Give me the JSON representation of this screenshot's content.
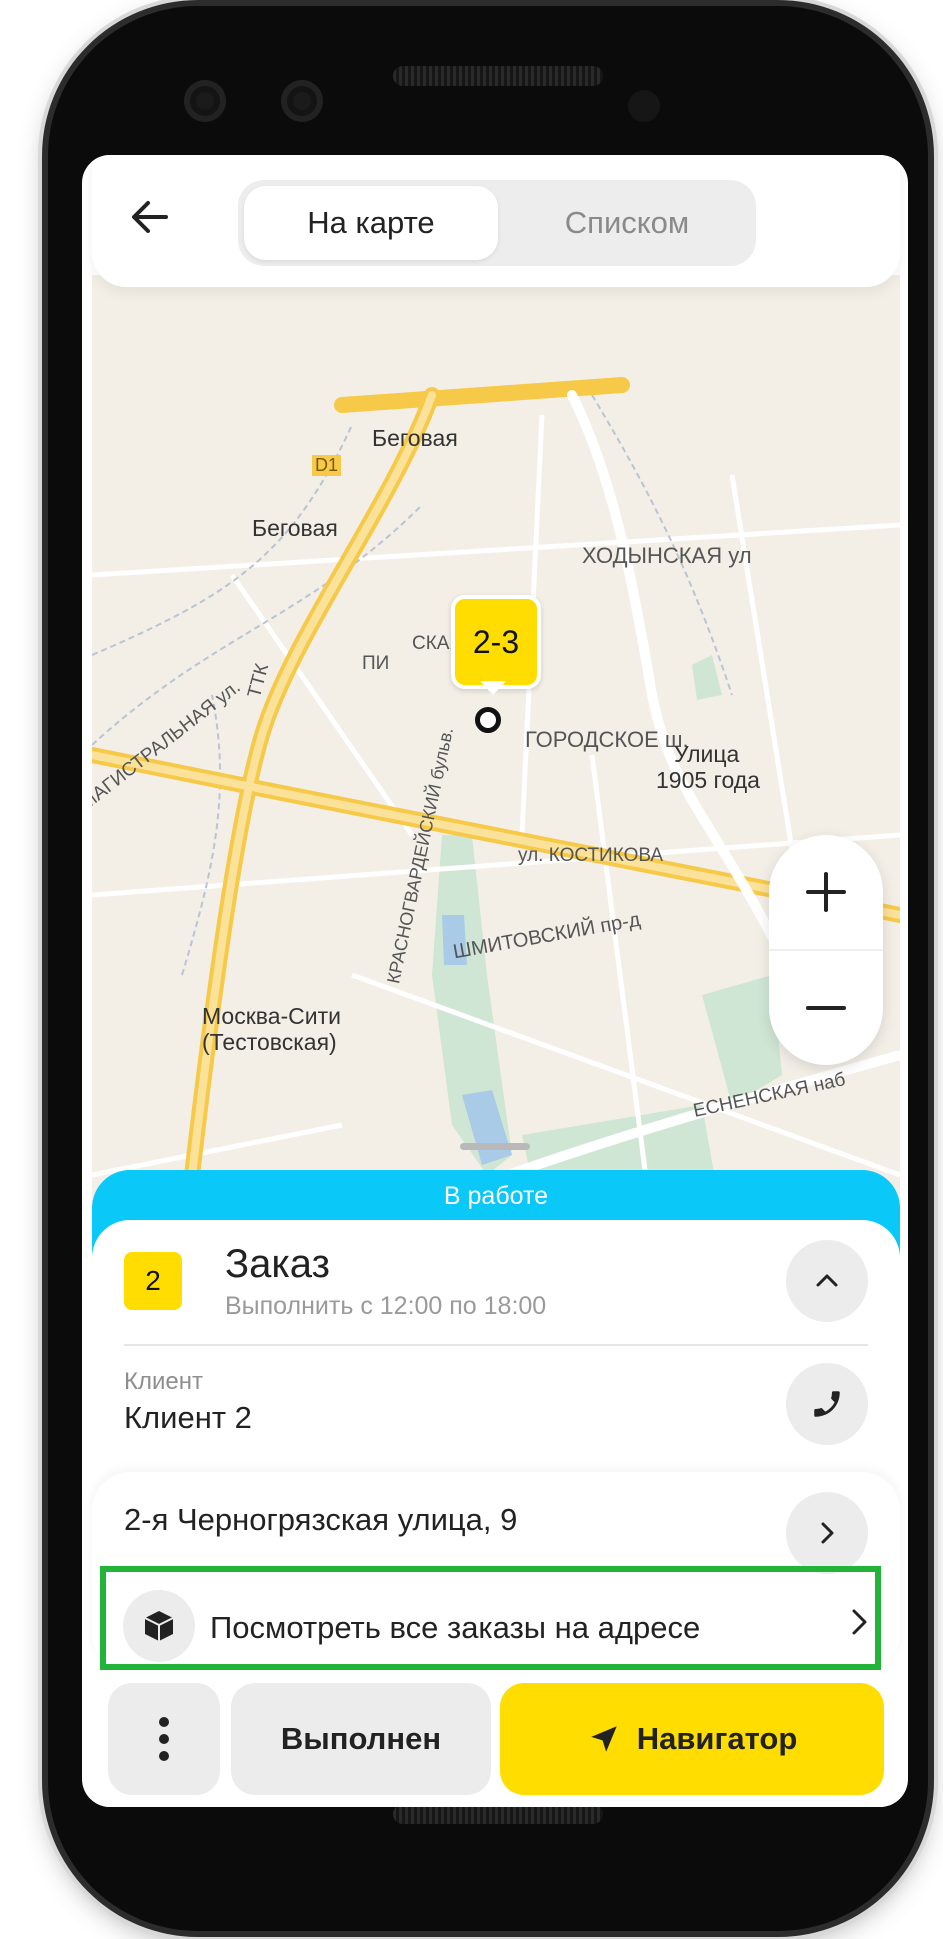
{
  "topbar": {
    "tabs": [
      {
        "label": "На карте",
        "active": true
      },
      {
        "label": "Списком",
        "active": false
      }
    ]
  },
  "map": {
    "badge": "2-3",
    "labels": {
      "metro_begovaya": "Беговая",
      "station_begovaya": "Беговая",
      "d1": "D1",
      "ttk": "ТТК",
      "khodynskaya": "ХОДЫНСКАЯ ул",
      "pischanaya": "ПИ",
      "skaya_al": "СКАЯ ал.",
      "zvenigorodskoe": "ГОРОДСКОЕ ш.",
      "ulitsa_1905": "Улица",
      "ulitsa_1905_b": "1905 года",
      "magistralnaya": "МАГИСТРАЛЬНАЯ ул.",
      "krasnogvardeysky": "КРАСНОГВАРДЕЙСКИЙ бульв.",
      "kostikova": "ул. КОСТИКОВА",
      "shmitovsky": "ШМИТОВСКИЙ пр-д",
      "moskva_city": "Москва-Сити",
      "testovskaya": "(Тестовская)",
      "presnenskaya": "ЕСНЕНСКАЯ наб",
      "moskva": "Москва"
    }
  },
  "sheet": {
    "status": "В работе",
    "order_number": "2",
    "order_title": "Заказ",
    "order_time": "Выполнить с 12:00 по 18:00",
    "client_label": "Клиент",
    "client_name": "Клиент 2",
    "address": "2-я Черногрязская улица, 9",
    "all_orders": "Посмотреть все заказы на адресе"
  },
  "actions": {
    "done": "Выполнен",
    "navigator": "Навигатор"
  },
  "colors": {
    "accent_yellow": "#ffdd00",
    "status_blue": "#0ac8f8",
    "highlight_green": "#22b339"
  }
}
